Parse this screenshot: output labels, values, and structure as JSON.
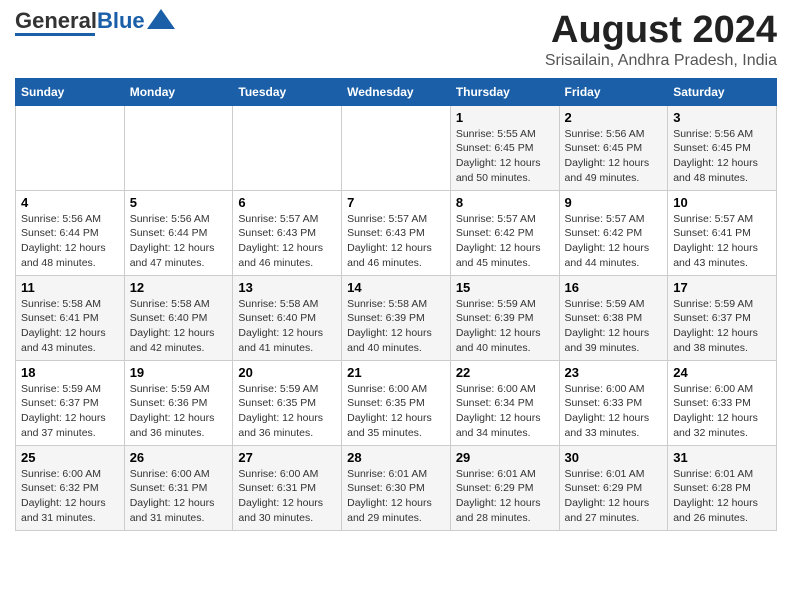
{
  "logo": {
    "text_general": "General",
    "text_blue": "Blue"
  },
  "header": {
    "title": "August 2024",
    "subtitle": "Srisailain, Andhra Pradesh, India"
  },
  "weekdays": [
    "Sunday",
    "Monday",
    "Tuesday",
    "Wednesday",
    "Thursday",
    "Friday",
    "Saturday"
  ],
  "weeks": [
    [
      {
        "day": "",
        "info": ""
      },
      {
        "day": "",
        "info": ""
      },
      {
        "day": "",
        "info": ""
      },
      {
        "day": "",
        "info": ""
      },
      {
        "day": "1",
        "info": "Sunrise: 5:55 AM\nSunset: 6:45 PM\nDaylight: 12 hours\nand 50 minutes."
      },
      {
        "day": "2",
        "info": "Sunrise: 5:56 AM\nSunset: 6:45 PM\nDaylight: 12 hours\nand 49 minutes."
      },
      {
        "day": "3",
        "info": "Sunrise: 5:56 AM\nSunset: 6:45 PM\nDaylight: 12 hours\nand 48 minutes."
      }
    ],
    [
      {
        "day": "4",
        "info": "Sunrise: 5:56 AM\nSunset: 6:44 PM\nDaylight: 12 hours\nand 48 minutes."
      },
      {
        "day": "5",
        "info": "Sunrise: 5:56 AM\nSunset: 6:44 PM\nDaylight: 12 hours\nand 47 minutes."
      },
      {
        "day": "6",
        "info": "Sunrise: 5:57 AM\nSunset: 6:43 PM\nDaylight: 12 hours\nand 46 minutes."
      },
      {
        "day": "7",
        "info": "Sunrise: 5:57 AM\nSunset: 6:43 PM\nDaylight: 12 hours\nand 46 minutes."
      },
      {
        "day": "8",
        "info": "Sunrise: 5:57 AM\nSunset: 6:42 PM\nDaylight: 12 hours\nand 45 minutes."
      },
      {
        "day": "9",
        "info": "Sunrise: 5:57 AM\nSunset: 6:42 PM\nDaylight: 12 hours\nand 44 minutes."
      },
      {
        "day": "10",
        "info": "Sunrise: 5:57 AM\nSunset: 6:41 PM\nDaylight: 12 hours\nand 43 minutes."
      }
    ],
    [
      {
        "day": "11",
        "info": "Sunrise: 5:58 AM\nSunset: 6:41 PM\nDaylight: 12 hours\nand 43 minutes."
      },
      {
        "day": "12",
        "info": "Sunrise: 5:58 AM\nSunset: 6:40 PM\nDaylight: 12 hours\nand 42 minutes."
      },
      {
        "day": "13",
        "info": "Sunrise: 5:58 AM\nSunset: 6:40 PM\nDaylight: 12 hours\nand 41 minutes."
      },
      {
        "day": "14",
        "info": "Sunrise: 5:58 AM\nSunset: 6:39 PM\nDaylight: 12 hours\nand 40 minutes."
      },
      {
        "day": "15",
        "info": "Sunrise: 5:59 AM\nSunset: 6:39 PM\nDaylight: 12 hours\nand 40 minutes."
      },
      {
        "day": "16",
        "info": "Sunrise: 5:59 AM\nSunset: 6:38 PM\nDaylight: 12 hours\nand 39 minutes."
      },
      {
        "day": "17",
        "info": "Sunrise: 5:59 AM\nSunset: 6:37 PM\nDaylight: 12 hours\nand 38 minutes."
      }
    ],
    [
      {
        "day": "18",
        "info": "Sunrise: 5:59 AM\nSunset: 6:37 PM\nDaylight: 12 hours\nand 37 minutes."
      },
      {
        "day": "19",
        "info": "Sunrise: 5:59 AM\nSunset: 6:36 PM\nDaylight: 12 hours\nand 36 minutes."
      },
      {
        "day": "20",
        "info": "Sunrise: 5:59 AM\nSunset: 6:35 PM\nDaylight: 12 hours\nand 36 minutes."
      },
      {
        "day": "21",
        "info": "Sunrise: 6:00 AM\nSunset: 6:35 PM\nDaylight: 12 hours\nand 35 minutes."
      },
      {
        "day": "22",
        "info": "Sunrise: 6:00 AM\nSunset: 6:34 PM\nDaylight: 12 hours\nand 34 minutes."
      },
      {
        "day": "23",
        "info": "Sunrise: 6:00 AM\nSunset: 6:33 PM\nDaylight: 12 hours\nand 33 minutes."
      },
      {
        "day": "24",
        "info": "Sunrise: 6:00 AM\nSunset: 6:33 PM\nDaylight: 12 hours\nand 32 minutes."
      }
    ],
    [
      {
        "day": "25",
        "info": "Sunrise: 6:00 AM\nSunset: 6:32 PM\nDaylight: 12 hours\nand 31 minutes."
      },
      {
        "day": "26",
        "info": "Sunrise: 6:00 AM\nSunset: 6:31 PM\nDaylight: 12 hours\nand 31 minutes."
      },
      {
        "day": "27",
        "info": "Sunrise: 6:00 AM\nSunset: 6:31 PM\nDaylight: 12 hours\nand 30 minutes."
      },
      {
        "day": "28",
        "info": "Sunrise: 6:01 AM\nSunset: 6:30 PM\nDaylight: 12 hours\nand 29 minutes."
      },
      {
        "day": "29",
        "info": "Sunrise: 6:01 AM\nSunset: 6:29 PM\nDaylight: 12 hours\nand 28 minutes."
      },
      {
        "day": "30",
        "info": "Sunrise: 6:01 AM\nSunset: 6:29 PM\nDaylight: 12 hours\nand 27 minutes."
      },
      {
        "day": "31",
        "info": "Sunrise: 6:01 AM\nSunset: 6:28 PM\nDaylight: 12 hours\nand 26 minutes."
      }
    ]
  ]
}
